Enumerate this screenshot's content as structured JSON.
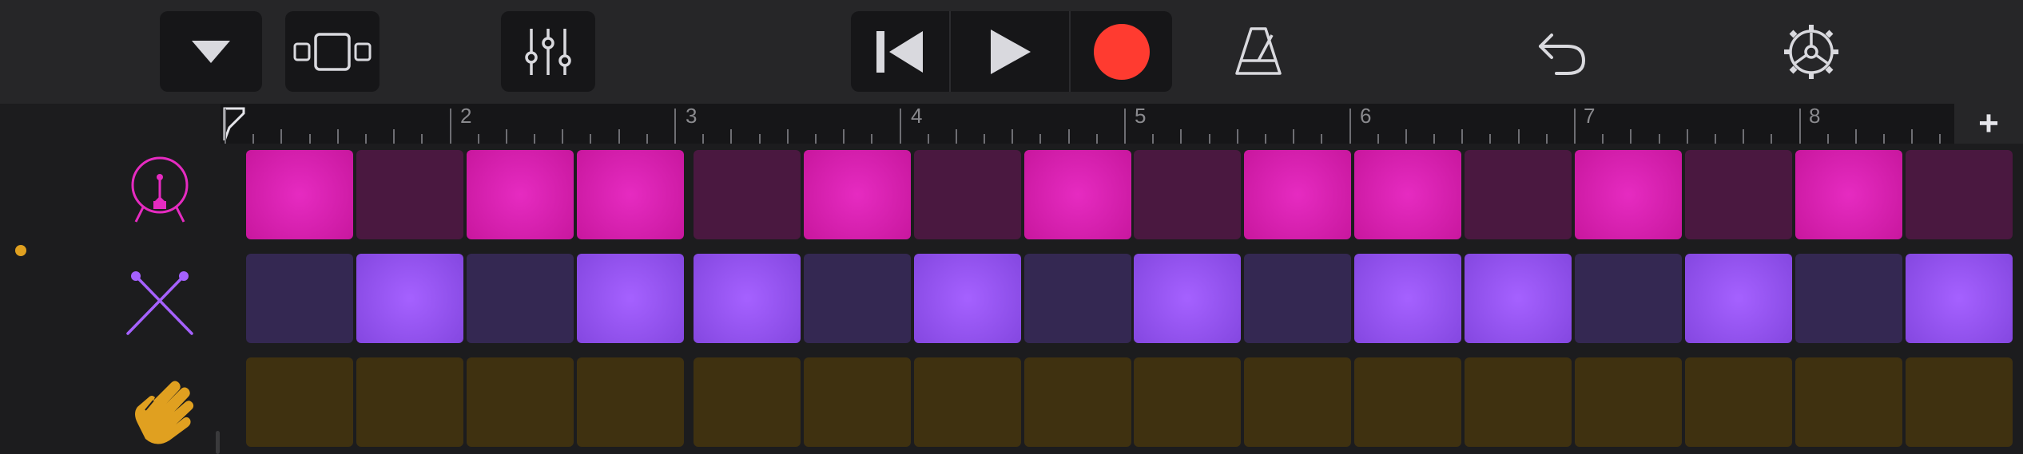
{
  "toolbar": {
    "buttons": [
      {
        "name": "browser-dropdown-button",
        "icon": "chevron-down-icon"
      },
      {
        "name": "view-toggle-button",
        "icon": "tracks-view-icon"
      },
      {
        "name": "mixer-button",
        "icon": "sliders-icon"
      },
      {
        "name": "go-to-beginning-button",
        "icon": "skip-back-icon"
      },
      {
        "name": "play-button",
        "icon": "play-icon"
      },
      {
        "name": "record-button",
        "icon": "record-icon"
      },
      {
        "name": "metronome-button",
        "icon": "metronome-icon"
      },
      {
        "name": "undo-button",
        "icon": "undo-icon"
      },
      {
        "name": "settings-button",
        "icon": "gear-icon"
      }
    ],
    "record_color": "#ff3b30"
  },
  "ruler": {
    "bars": [
      "2",
      "3",
      "4",
      "5",
      "6",
      "7",
      "8"
    ],
    "add_label": "+"
  },
  "tracks": [
    {
      "name": "bass-drum",
      "icon": "kick-drum-icon",
      "color": "#e62bc1",
      "steps": [
        1,
        0,
        1,
        1,
        0,
        1,
        0,
        1,
        0,
        1,
        1,
        0,
        1,
        0,
        1,
        0
      ]
    },
    {
      "name": "sticks",
      "icon": "drumsticks-icon",
      "color": "#a561ff",
      "steps": [
        0,
        1,
        0,
        1,
        1,
        0,
        1,
        0,
        1,
        0,
        1,
        1,
        0,
        1,
        0,
        1
      ]
    },
    {
      "name": "clap",
      "icon": "hand-clap-icon",
      "color": "#e0a020",
      "steps": [
        0,
        0,
        0,
        0,
        0,
        0,
        0,
        0,
        0,
        0,
        0,
        0,
        0,
        0,
        0,
        0
      ]
    }
  ],
  "indicator_color": "#e0a020"
}
